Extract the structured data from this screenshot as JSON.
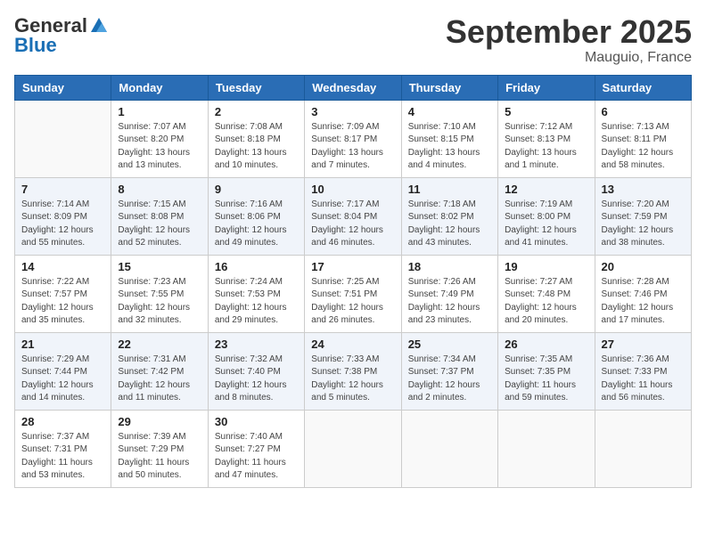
{
  "header": {
    "logo_general": "General",
    "logo_blue": "Blue",
    "month": "September 2025",
    "location": "Mauguio, France"
  },
  "days_of_week": [
    "Sunday",
    "Monday",
    "Tuesday",
    "Wednesday",
    "Thursday",
    "Friday",
    "Saturday"
  ],
  "weeks": [
    [
      {
        "day": "",
        "info": ""
      },
      {
        "day": "1",
        "info": "Sunrise: 7:07 AM\nSunset: 8:20 PM\nDaylight: 13 hours\nand 13 minutes."
      },
      {
        "day": "2",
        "info": "Sunrise: 7:08 AM\nSunset: 8:18 PM\nDaylight: 13 hours\nand 10 minutes."
      },
      {
        "day": "3",
        "info": "Sunrise: 7:09 AM\nSunset: 8:17 PM\nDaylight: 13 hours\nand 7 minutes."
      },
      {
        "day": "4",
        "info": "Sunrise: 7:10 AM\nSunset: 8:15 PM\nDaylight: 13 hours\nand 4 minutes."
      },
      {
        "day": "5",
        "info": "Sunrise: 7:12 AM\nSunset: 8:13 PM\nDaylight: 13 hours\nand 1 minute."
      },
      {
        "day": "6",
        "info": "Sunrise: 7:13 AM\nSunset: 8:11 PM\nDaylight: 12 hours\nand 58 minutes."
      }
    ],
    [
      {
        "day": "7",
        "info": "Sunrise: 7:14 AM\nSunset: 8:09 PM\nDaylight: 12 hours\nand 55 minutes."
      },
      {
        "day": "8",
        "info": "Sunrise: 7:15 AM\nSunset: 8:08 PM\nDaylight: 12 hours\nand 52 minutes."
      },
      {
        "day": "9",
        "info": "Sunrise: 7:16 AM\nSunset: 8:06 PM\nDaylight: 12 hours\nand 49 minutes."
      },
      {
        "day": "10",
        "info": "Sunrise: 7:17 AM\nSunset: 8:04 PM\nDaylight: 12 hours\nand 46 minutes."
      },
      {
        "day": "11",
        "info": "Sunrise: 7:18 AM\nSunset: 8:02 PM\nDaylight: 12 hours\nand 43 minutes."
      },
      {
        "day": "12",
        "info": "Sunrise: 7:19 AM\nSunset: 8:00 PM\nDaylight: 12 hours\nand 41 minutes."
      },
      {
        "day": "13",
        "info": "Sunrise: 7:20 AM\nSunset: 7:59 PM\nDaylight: 12 hours\nand 38 minutes."
      }
    ],
    [
      {
        "day": "14",
        "info": "Sunrise: 7:22 AM\nSunset: 7:57 PM\nDaylight: 12 hours\nand 35 minutes."
      },
      {
        "day": "15",
        "info": "Sunrise: 7:23 AM\nSunset: 7:55 PM\nDaylight: 12 hours\nand 32 minutes."
      },
      {
        "day": "16",
        "info": "Sunrise: 7:24 AM\nSunset: 7:53 PM\nDaylight: 12 hours\nand 29 minutes."
      },
      {
        "day": "17",
        "info": "Sunrise: 7:25 AM\nSunset: 7:51 PM\nDaylight: 12 hours\nand 26 minutes."
      },
      {
        "day": "18",
        "info": "Sunrise: 7:26 AM\nSunset: 7:49 PM\nDaylight: 12 hours\nand 23 minutes."
      },
      {
        "day": "19",
        "info": "Sunrise: 7:27 AM\nSunset: 7:48 PM\nDaylight: 12 hours\nand 20 minutes."
      },
      {
        "day": "20",
        "info": "Sunrise: 7:28 AM\nSunset: 7:46 PM\nDaylight: 12 hours\nand 17 minutes."
      }
    ],
    [
      {
        "day": "21",
        "info": "Sunrise: 7:29 AM\nSunset: 7:44 PM\nDaylight: 12 hours\nand 14 minutes."
      },
      {
        "day": "22",
        "info": "Sunrise: 7:31 AM\nSunset: 7:42 PM\nDaylight: 12 hours\nand 11 minutes."
      },
      {
        "day": "23",
        "info": "Sunrise: 7:32 AM\nSunset: 7:40 PM\nDaylight: 12 hours\nand 8 minutes."
      },
      {
        "day": "24",
        "info": "Sunrise: 7:33 AM\nSunset: 7:38 PM\nDaylight: 12 hours\nand 5 minutes."
      },
      {
        "day": "25",
        "info": "Sunrise: 7:34 AM\nSunset: 7:37 PM\nDaylight: 12 hours\nand 2 minutes."
      },
      {
        "day": "26",
        "info": "Sunrise: 7:35 AM\nSunset: 7:35 PM\nDaylight: 11 hours\nand 59 minutes."
      },
      {
        "day": "27",
        "info": "Sunrise: 7:36 AM\nSunset: 7:33 PM\nDaylight: 11 hours\nand 56 minutes."
      }
    ],
    [
      {
        "day": "28",
        "info": "Sunrise: 7:37 AM\nSunset: 7:31 PM\nDaylight: 11 hours\nand 53 minutes."
      },
      {
        "day": "29",
        "info": "Sunrise: 7:39 AM\nSunset: 7:29 PM\nDaylight: 11 hours\nand 50 minutes."
      },
      {
        "day": "30",
        "info": "Sunrise: 7:40 AM\nSunset: 7:27 PM\nDaylight: 11 hours\nand 47 minutes."
      },
      {
        "day": "",
        "info": ""
      },
      {
        "day": "",
        "info": ""
      },
      {
        "day": "",
        "info": ""
      },
      {
        "day": "",
        "info": ""
      }
    ]
  ]
}
